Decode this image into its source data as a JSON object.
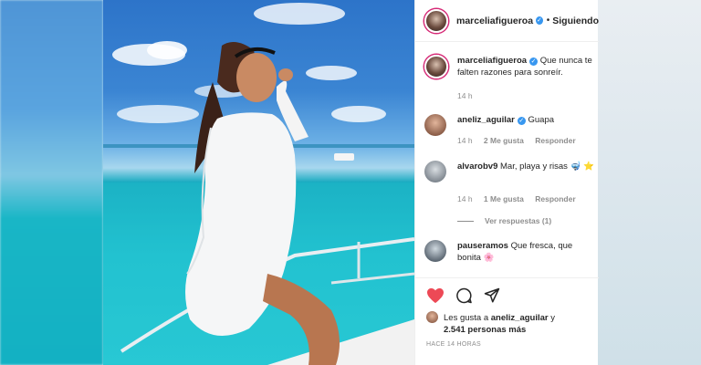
{
  "post": {
    "author": "marceliafigueroa",
    "follow_status": "Siguiendo",
    "caption_author": "marceliafigueroa",
    "caption": "Que nunca te falten razones para sonreír.",
    "caption_time": "14 h"
  },
  "comments": [
    {
      "user": "aneliz_aguilar",
      "verified": true,
      "text": "Guapa",
      "time": "14 h",
      "likes": "2 Me gusta",
      "reply": "Responder"
    },
    {
      "user": "alvarobv9",
      "verified": false,
      "text": "Mar, playa y risas 🤿 ⭐",
      "time": "14 h",
      "likes": "1 Me gusta",
      "reply": "Responder",
      "view_replies": "Ver respuestas (1)"
    },
    {
      "user": "pauseramos",
      "verified": false,
      "text": "Que fresca, que bonita 🌸",
      "time": "",
      "likes": "",
      "reply": ""
    }
  ],
  "footer": {
    "liked_by_prefix": "Les gusta a",
    "liked_by_user": "aneliz_aguilar",
    "liked_by_mid": "y",
    "others": "2.541 personas más",
    "time_ago": "HACE 14 HORAS"
  },
  "colors": {
    "like_red": "#ed4956",
    "verified_blue": "#3897f0",
    "text": "#262626",
    "muted": "#8e8e8e"
  },
  "icons": [
    "heart-icon",
    "comment-icon",
    "share-icon",
    "verified-icon"
  ]
}
